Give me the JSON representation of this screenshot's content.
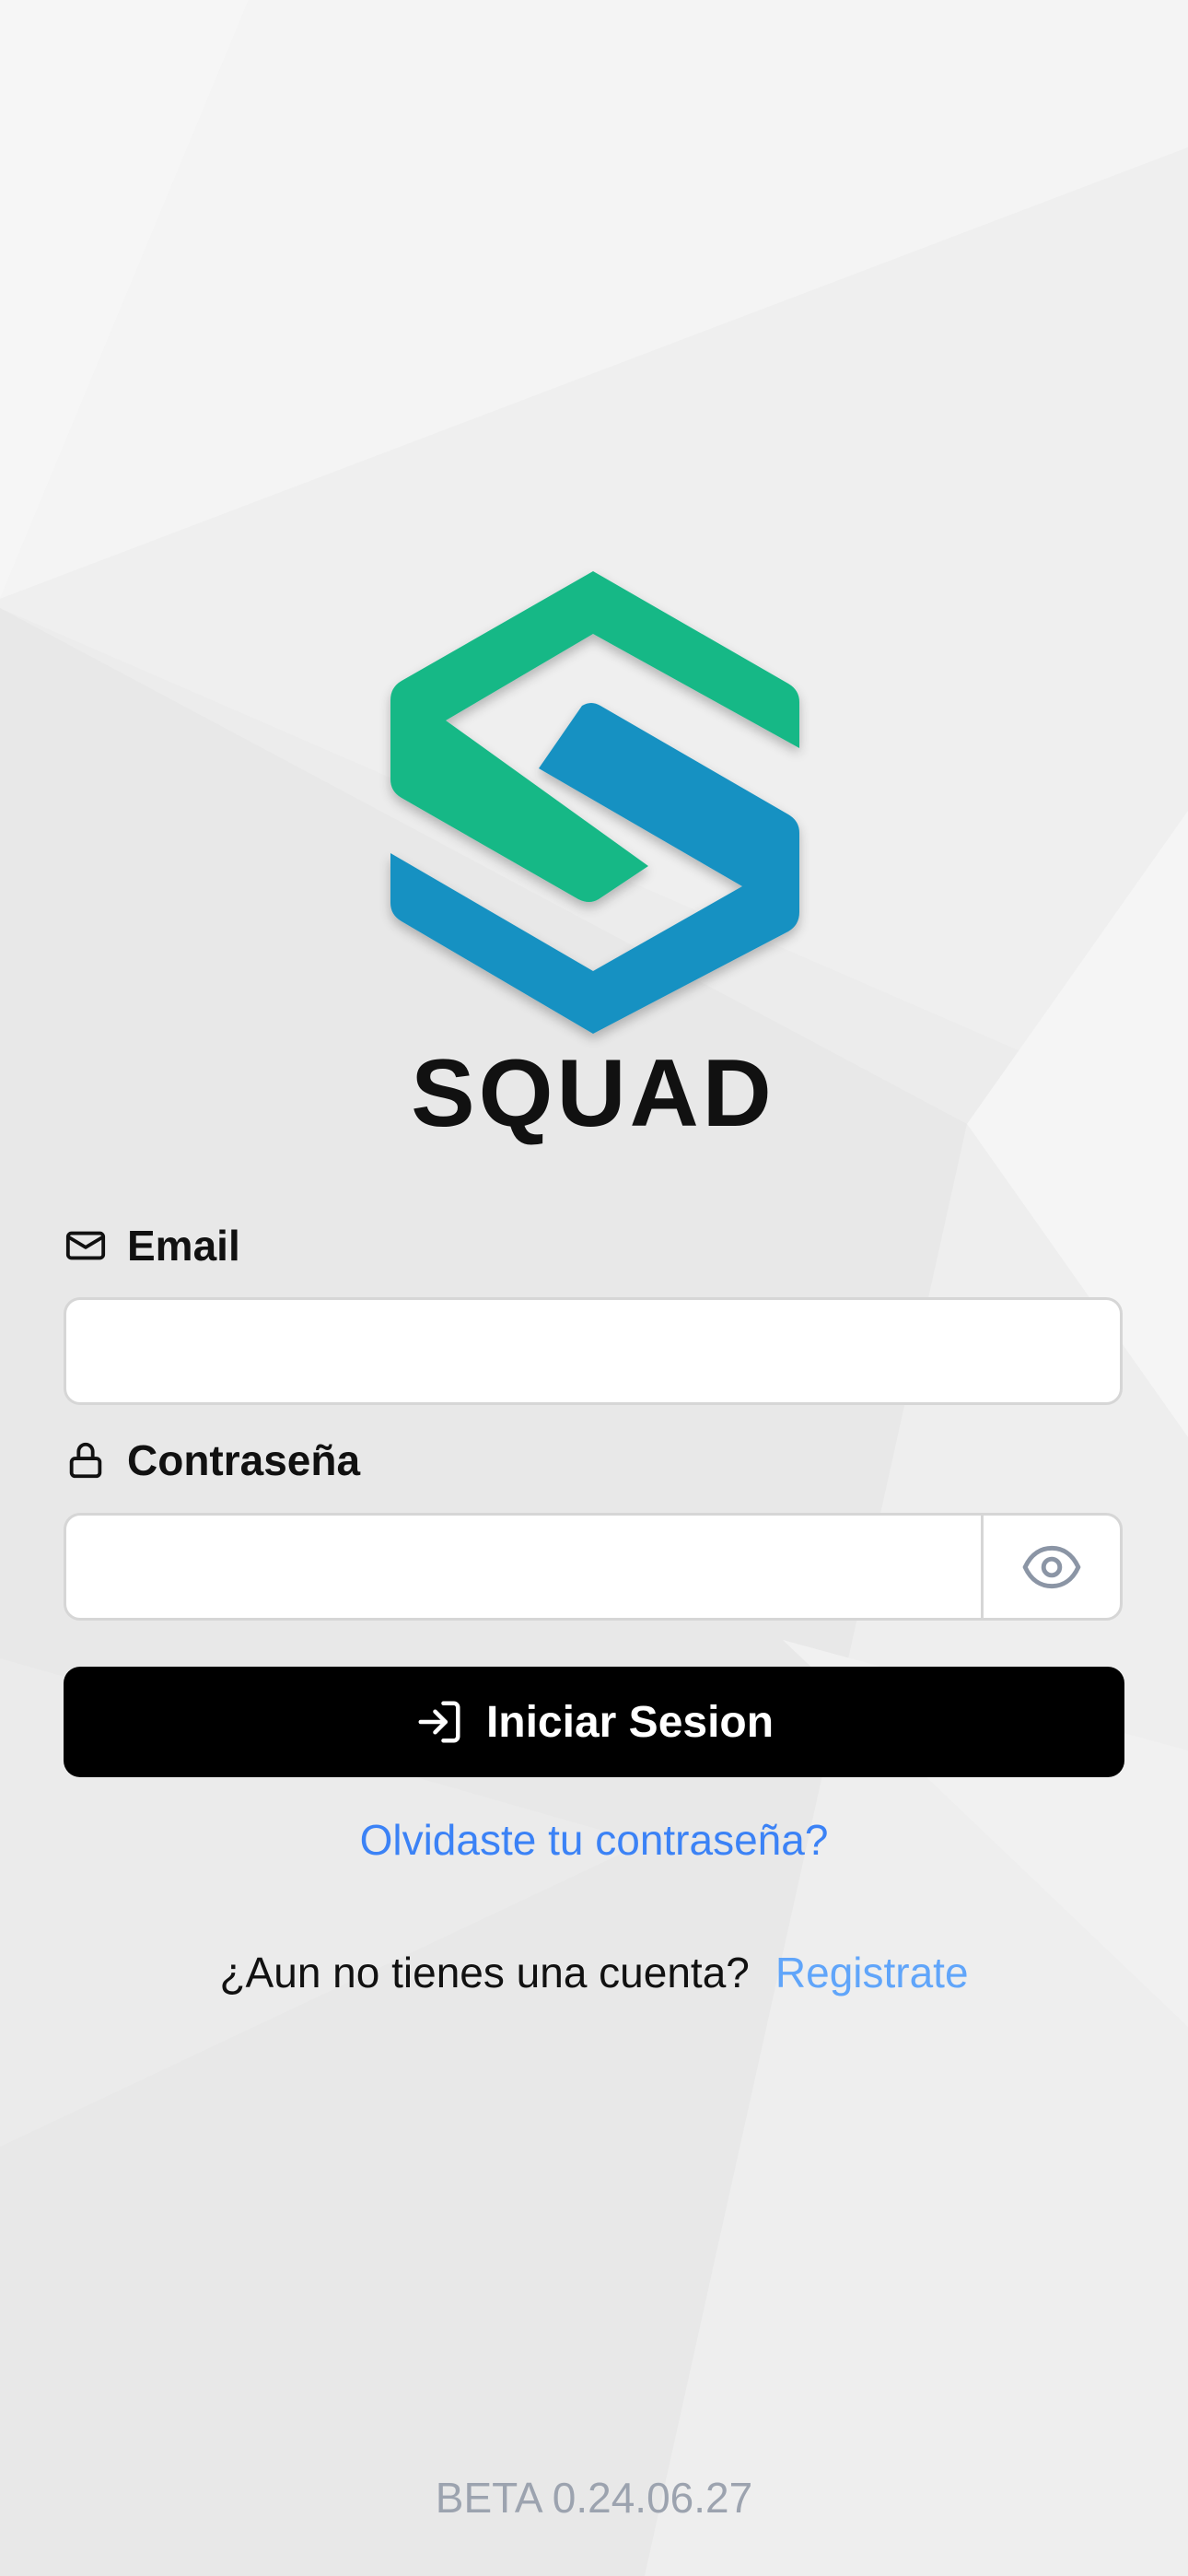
{
  "brand": {
    "name": "SQUAD",
    "colors": {
      "green": "#16b886",
      "blue": "#1591c2",
      "dark": "#111111"
    }
  },
  "form": {
    "email_label": "Email",
    "email_icon": "envelope-icon",
    "email_value": "",
    "password_label": "Contraseña",
    "password_icon": "lock-icon",
    "password_value": "",
    "toggle_visibility_icon": "eye-icon",
    "submit_label": "Iniciar Sesion",
    "submit_icon": "login-arrow-icon"
  },
  "links": {
    "forgot_password": "Olvidaste tu contraseña?",
    "no_account_question": "¿Aun no tienes una cuenta?",
    "register": "Registrate"
  },
  "footer": {
    "version": "BETA 0.24.06.27"
  },
  "colors": {
    "link": "#3b82f6",
    "link_light": "#60a5fa",
    "button_bg": "#000000",
    "muted": "#9ca3af"
  }
}
